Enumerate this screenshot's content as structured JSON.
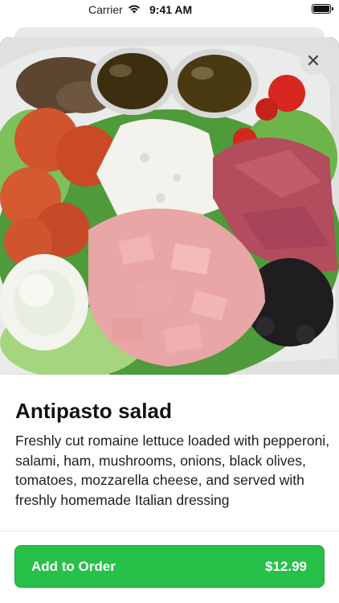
{
  "status_bar": {
    "carrier": "Carrier",
    "time": "9:41 AM",
    "wifi_icon": "wifi-icon",
    "battery_icon": "battery-icon"
  },
  "item": {
    "image_alt": "antipasto-salad-photo",
    "title": "Antipasto salad",
    "description": "Freshly cut romaine lettuce loaded with pepperoni, salami, ham, mushrooms, onions, black olives, tomatoes, mozzarella cheese, and served with freshly homemade Italian dressing"
  },
  "close_button": {
    "icon": "close-icon",
    "glyph": "✕"
  },
  "order_button": {
    "label": "Add to Order",
    "price": "$12.99"
  },
  "colors": {
    "accent": "#27c049",
    "text": "#111111"
  }
}
